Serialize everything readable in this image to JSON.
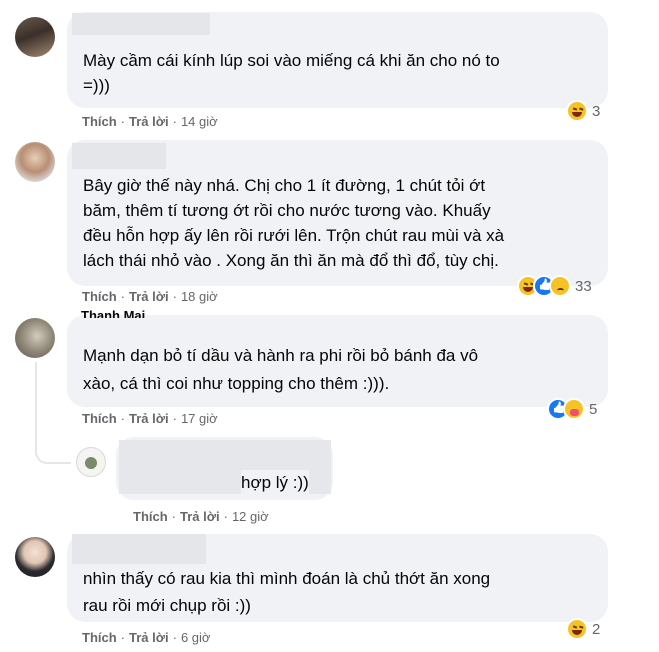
{
  "comments": [
    {
      "text_lines": [
        "Mày cầm cái kính lúp soi vào miếng cá khi ăn cho nó to",
        "=)))"
      ],
      "actions": {
        "like": "Thích",
        "reply": "Trả lời",
        "time": "14 giờ"
      },
      "reactions": {
        "icons": [
          "haha-icon"
        ],
        "count": "3"
      }
    },
    {
      "text_lines": [
        "Bây giờ thế này nhá. Chị cho 1 ít đường, 1 chút tỏi ớt",
        "băm, thêm tí tương ớt rồi cho nước tương vào. Khuấy",
        "đều hỗn hợp ấy lên rồi rưới lên. Trộn chút rau mùi và xà",
        "lách thái nhỏ vào . Xong ăn thì ăn mà đổ thì đổ, tùy chị."
      ],
      "actions": {
        "like": "Thích",
        "reply": "Trả lời",
        "time": "18 giờ"
      },
      "reactions": {
        "icons": [
          "haha-icon",
          "like-icon",
          "sad-icon"
        ],
        "count": "33"
      }
    },
    {
      "author": "Thanh Mai",
      "text_lines": [
        "Mạnh dạn bỏ tí dầu và hành ra phi rồi bỏ bánh đa vô",
        "xào, cá thì coi như topping cho thêm :)))."
      ],
      "actions": {
        "like": "Thích",
        "reply": "Trả lời",
        "time": "17 giờ"
      },
      "reactions": {
        "icons": [
          "like-icon",
          "care-icon"
        ],
        "count": "5"
      }
    },
    {
      "text_lines": [
        "hợp lý :))"
      ],
      "actions": {
        "like": "Thích",
        "reply": "Trả lời",
        "time": "12 giờ"
      }
    },
    {
      "text_lines": [
        "nhìn thấy có rau kia thì mình đoán là chủ thớt ăn xong",
        "rau rồi mới chụp rồi :))"
      ],
      "actions": {
        "like": "Thích",
        "reply": "Trả lời",
        "time": "6 giờ"
      },
      "reactions": {
        "icons": [
          "haha-icon"
        ],
        "count": "2"
      }
    }
  ],
  "colors": {
    "bubble": "#f0f2f5",
    "meta": "#65676b",
    "text": "#050505",
    "like": "#1877f2",
    "haha": "#f7c324"
  }
}
